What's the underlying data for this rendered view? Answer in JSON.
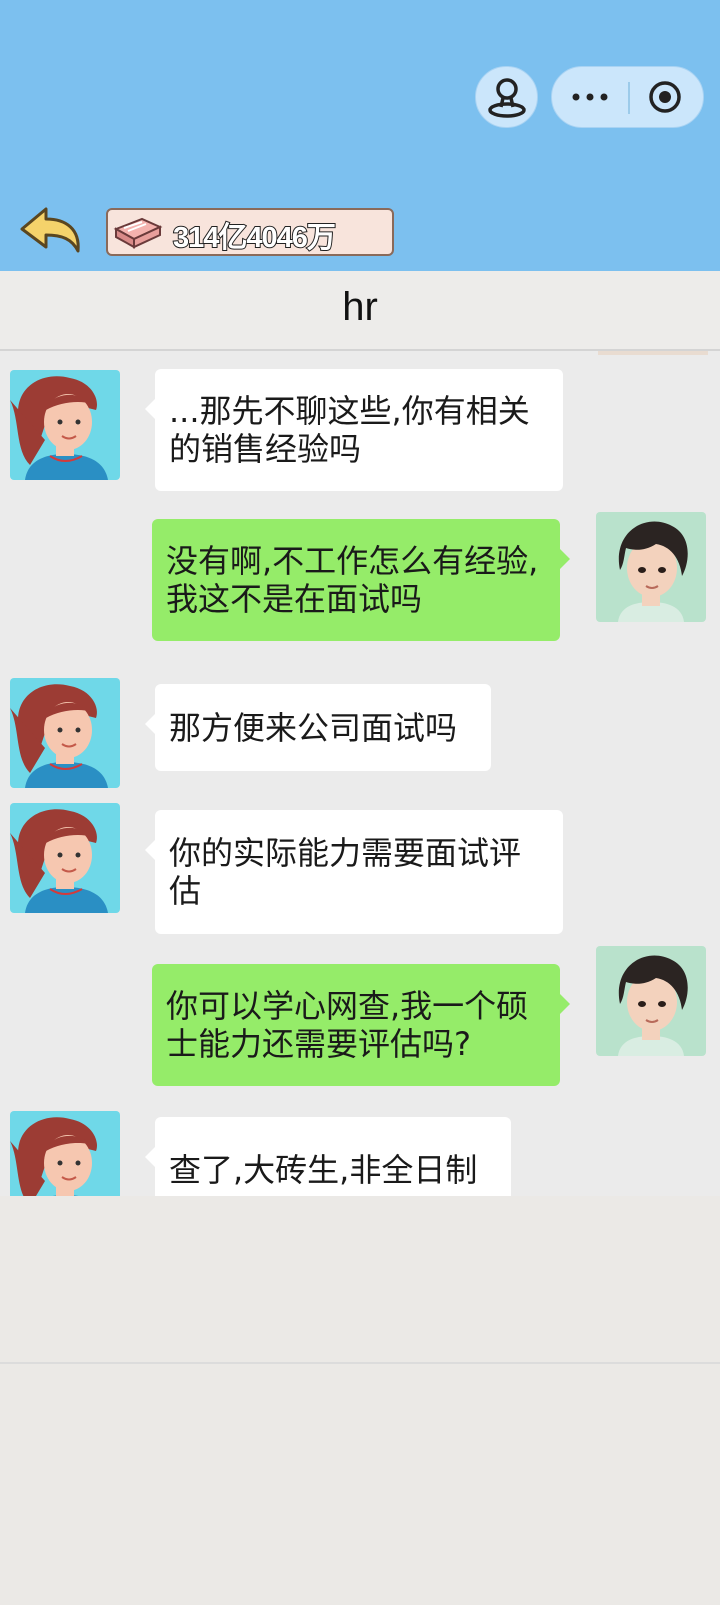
{
  "topbar": {
    "bg_color": "#7cc0ef",
    "profile_icon": "person-pin-icon",
    "menu_icon": "more-dots-icon",
    "close_icon": "target-circle-icon",
    "back_icon": "back-arrow-icon",
    "money_icon": "money-brick-icon",
    "money": "314亿4046万"
  },
  "chat": {
    "title": "hr",
    "messages": [
      {
        "sender": "hr",
        "text": "...那先不聊这些,你有相关的销售经验吗"
      },
      {
        "sender": "me",
        "text": "没有啊,不工作怎么有经验,我这不是在面试吗"
      },
      {
        "sender": "hr",
        "text": "那方便来公司面试吗"
      },
      {
        "sender": "hr",
        "text": "你的实际能力需要面试评估"
      },
      {
        "sender": "me",
        "text": "你可以学心网查,我一个硕士能力还需要评估吗?"
      },
      {
        "sender": "hr",
        "text": "查了,大砖生,非全日制"
      }
    ]
  },
  "colors": {
    "outgoing_bubble": "#95ec69",
    "incoming_bubble": "#ffffff",
    "chat_bg": "#ebebeb"
  }
}
